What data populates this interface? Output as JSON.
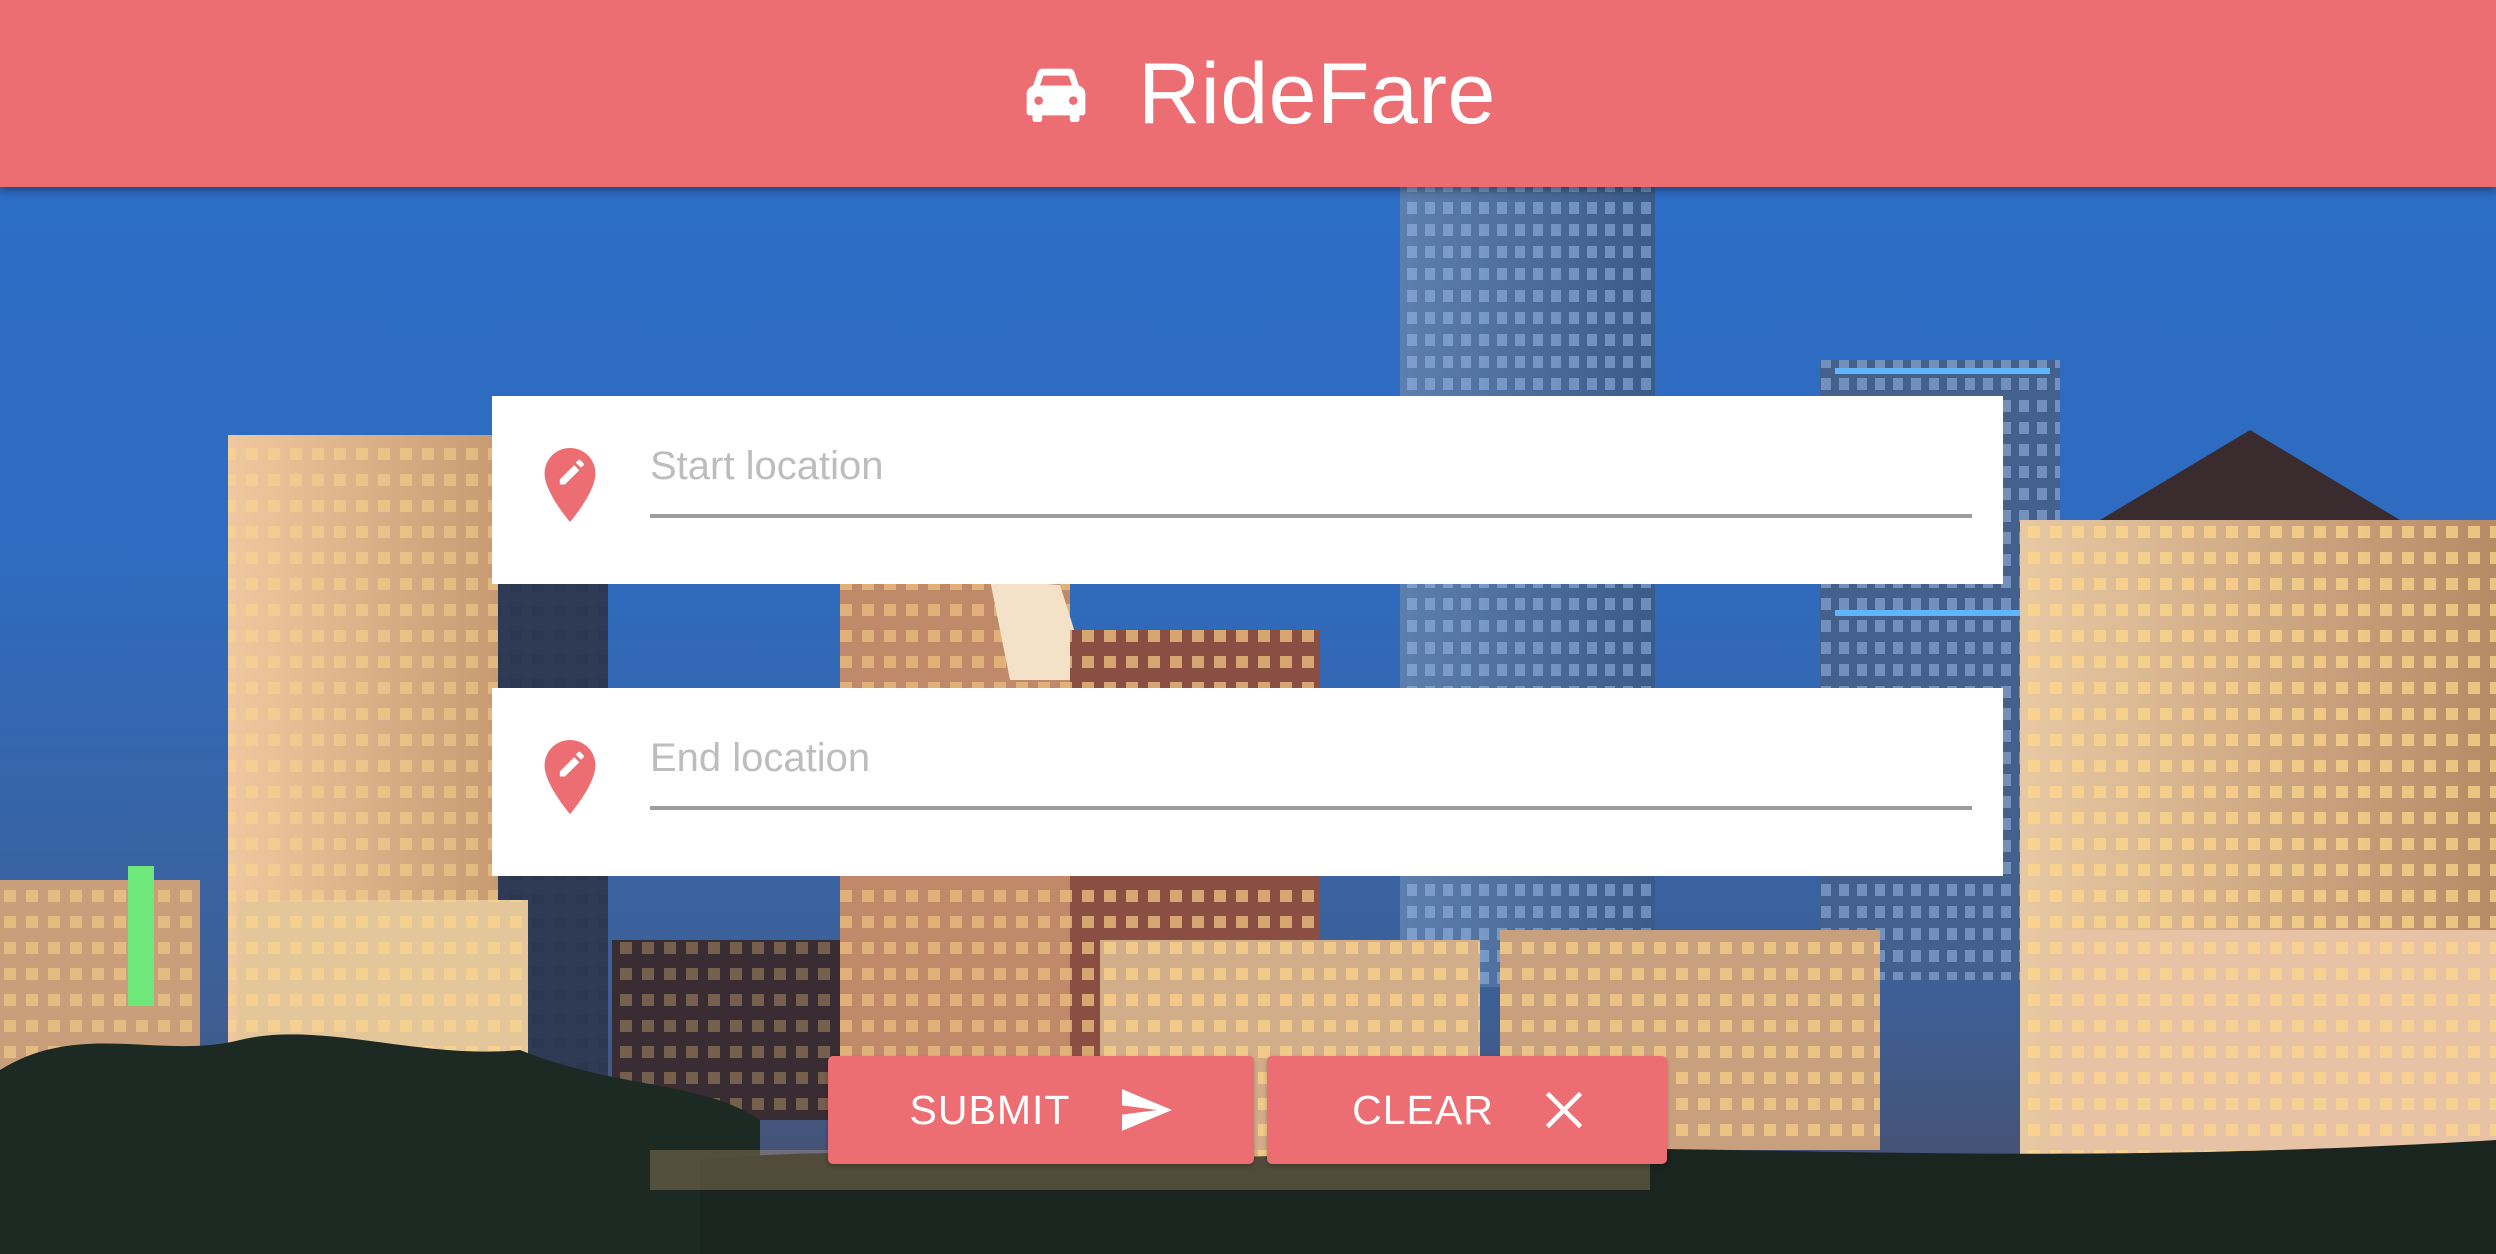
{
  "header": {
    "app_title": "RideFare",
    "icon": "car-icon"
  },
  "form": {
    "start": {
      "placeholder": "Start location",
      "value": "",
      "icon": "edit-location-icon"
    },
    "end": {
      "placeholder": "End location",
      "value": "",
      "icon": "edit-location-icon"
    }
  },
  "actions": {
    "submit_label": "SUBMIT",
    "submit_icon": "send-icon",
    "clear_label": "CLEAR",
    "clear_icon": "close-icon"
  },
  "colors": {
    "accent": "#ec6e73",
    "card": "#ffffff",
    "underline": "#9e9e9e",
    "placeholder": "#bdbdbd"
  }
}
